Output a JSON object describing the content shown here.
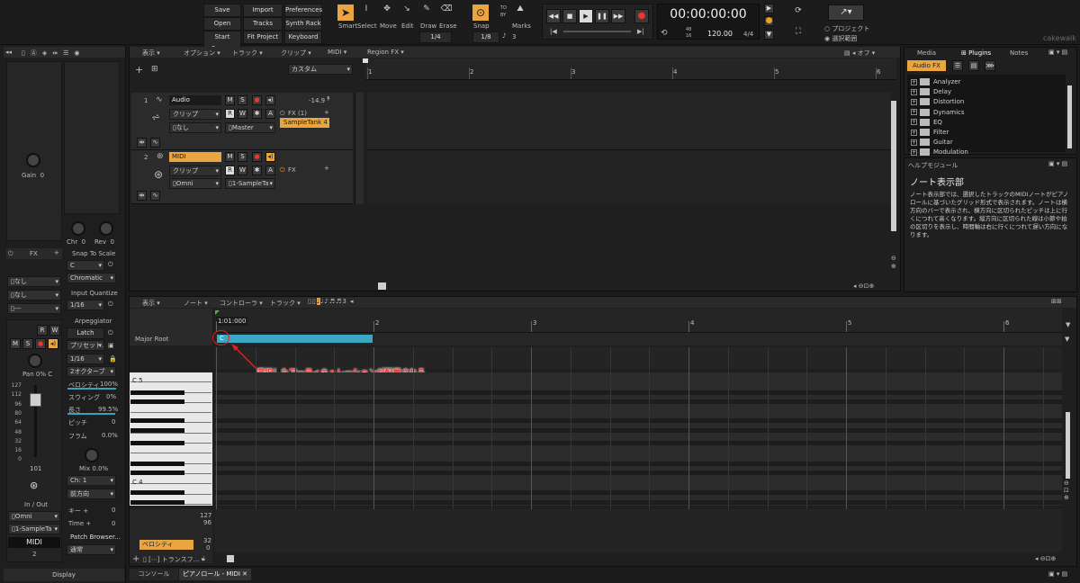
{
  "toolbar": {
    "save": "Save",
    "import": "Import",
    "preferences": "Preferences",
    "open": "Open",
    "tracks": "Tracks",
    "synth_rack": "Synth Rack",
    "start_screen": "Start Screen",
    "fit_project": "Fit Project",
    "keyboard": "Keyboard",
    "tools": {
      "smart": "Smart",
      "select": "Select",
      "move": "Move",
      "edit": "Edit",
      "draw": "Draw",
      "erase": "Erase"
    },
    "draw_res": "1/4",
    "snap": "Snap",
    "snap_to": "TO",
    "snap_by": "BY",
    "snap_value": "1/8",
    "snap_count": "3",
    "marks": "Marks",
    "time": "00:00:00:00",
    "time_sig_top": "48",
    "time_sig_bottom": "16",
    "tempo": "120.00",
    "meter": "4/4",
    "proj_opt1": "プロジェクト",
    "proj_opt2": "選択範囲",
    "brand": "cakewalk"
  },
  "left_strip": {
    "gain_label": "Gain",
    "gain_value": "0",
    "chr": "Chr",
    "chr_val": "0",
    "rev": "Rev",
    "rev_val": "0",
    "fx": "FX",
    "snap_scale": "Snap To Scale",
    "scale_root": "C",
    "scale_type": "Chromatic",
    "input_quantize": "Input Quantize",
    "iq_value": "1/16",
    "arpeggiator": "Arpeggiator",
    "latch": "Latch",
    "preset": "プリセット...",
    "arp_div": "1/16",
    "octave": "2オクターブ",
    "velocity_lbl": "ベロシティ",
    "velocity_val": "100%",
    "swing_lbl": "スウィング",
    "swing_val": "0%",
    "length_lbl": "長さ",
    "length_val": "99.5%",
    "pitch_lbl": "ピッチ",
    "pitch_val": "0",
    "flam_lbl": "フラム",
    "flam_val": "0.0%",
    "mix_lbl": "Mix",
    "mix_val": "0.0%",
    "channel": "Ch: 1",
    "direction": "前方向",
    "key_lbl": "キー +",
    "key_val": "0",
    "time_lbl": "Time +",
    "time_val": "0",
    "patch_browser": "Patch Browser...",
    "normal": "通常",
    "nashi1": "なし",
    "nashi2": "なし",
    "dash": "---",
    "pan_lbl": "Pan",
    "pan_val": "0% C",
    "fader_val": "101",
    "in_out": "In / Out",
    "in_omni": "Omni",
    "out_sample": "1-SampleTa",
    "track_name": "MIDI",
    "track_num": "2",
    "display": "Display",
    "fader_scale": [
      "127",
      "112",
      "96",
      "80",
      "64",
      "48",
      "32",
      "16",
      "0"
    ]
  },
  "track_view": {
    "menus": [
      "表示",
      "オプション",
      "トラック",
      "クリップ",
      "MIDI",
      "Region FX"
    ],
    "off": "オフ",
    "custom": "カスタム",
    "ruler": [
      "1",
      "2",
      "3",
      "4",
      "5",
      "6"
    ],
    "tracks": [
      {
        "num": "1",
        "name": "Audio",
        "clip": "クリップ",
        "input": "なし",
        "output": "Master",
        "fx": "FX (1)",
        "fx_item": "SampleTank 4",
        "level": "-14.9"
      },
      {
        "num": "2",
        "name": "MIDI",
        "clip": "クリップ",
        "input": "Omni",
        "output": "1-SampleTa",
        "fx": "FX"
      }
    ]
  },
  "browser": {
    "tabs": [
      "Media",
      "Plugins",
      "Notes"
    ],
    "audio_fx": "Audio FX",
    "categories": [
      "Analyzer",
      "Delay",
      "Distortion",
      "Dynamics",
      "EQ",
      "Filter",
      "Guitar",
      "Modulation"
    ]
  },
  "help": {
    "title": "ヘルプモジュール",
    "heading": "ノート表示部",
    "body": "ノート表示部では、選択したトラックのMIDIノートがピアノロールに基づいたグリッド形式で表示されます。ノートは横方向のバーで表示され、横方向に区切られたピッチは上に行くにつれて高くなります。縦方向に区切られた線は小節や拍の区切りを表示し、時間軸は右に行くにつれて遅い方向になります。"
  },
  "piano_roll": {
    "menus": [
      "表示",
      "ノート",
      "コントローラ",
      "トラック"
    ],
    "start_time": "1:01:000",
    "ruler": [
      "2",
      "3",
      "4",
      "5",
      "6"
    ],
    "lane_label": "Major Root",
    "note_label": "C",
    "annotation": "選択したアーティキュレーションが配置される",
    "c5": "C 5",
    "c4": "C 4",
    "vel_top": "127",
    "vel_mid": "96",
    "vel_32": "32",
    "vel_0": "0",
    "velocity_btn": "ベロシティ",
    "transform": "トランスフ..."
  },
  "bottom_tabs": {
    "console": "コンソール",
    "piano_roll": "ピアノロール - MIDI"
  }
}
